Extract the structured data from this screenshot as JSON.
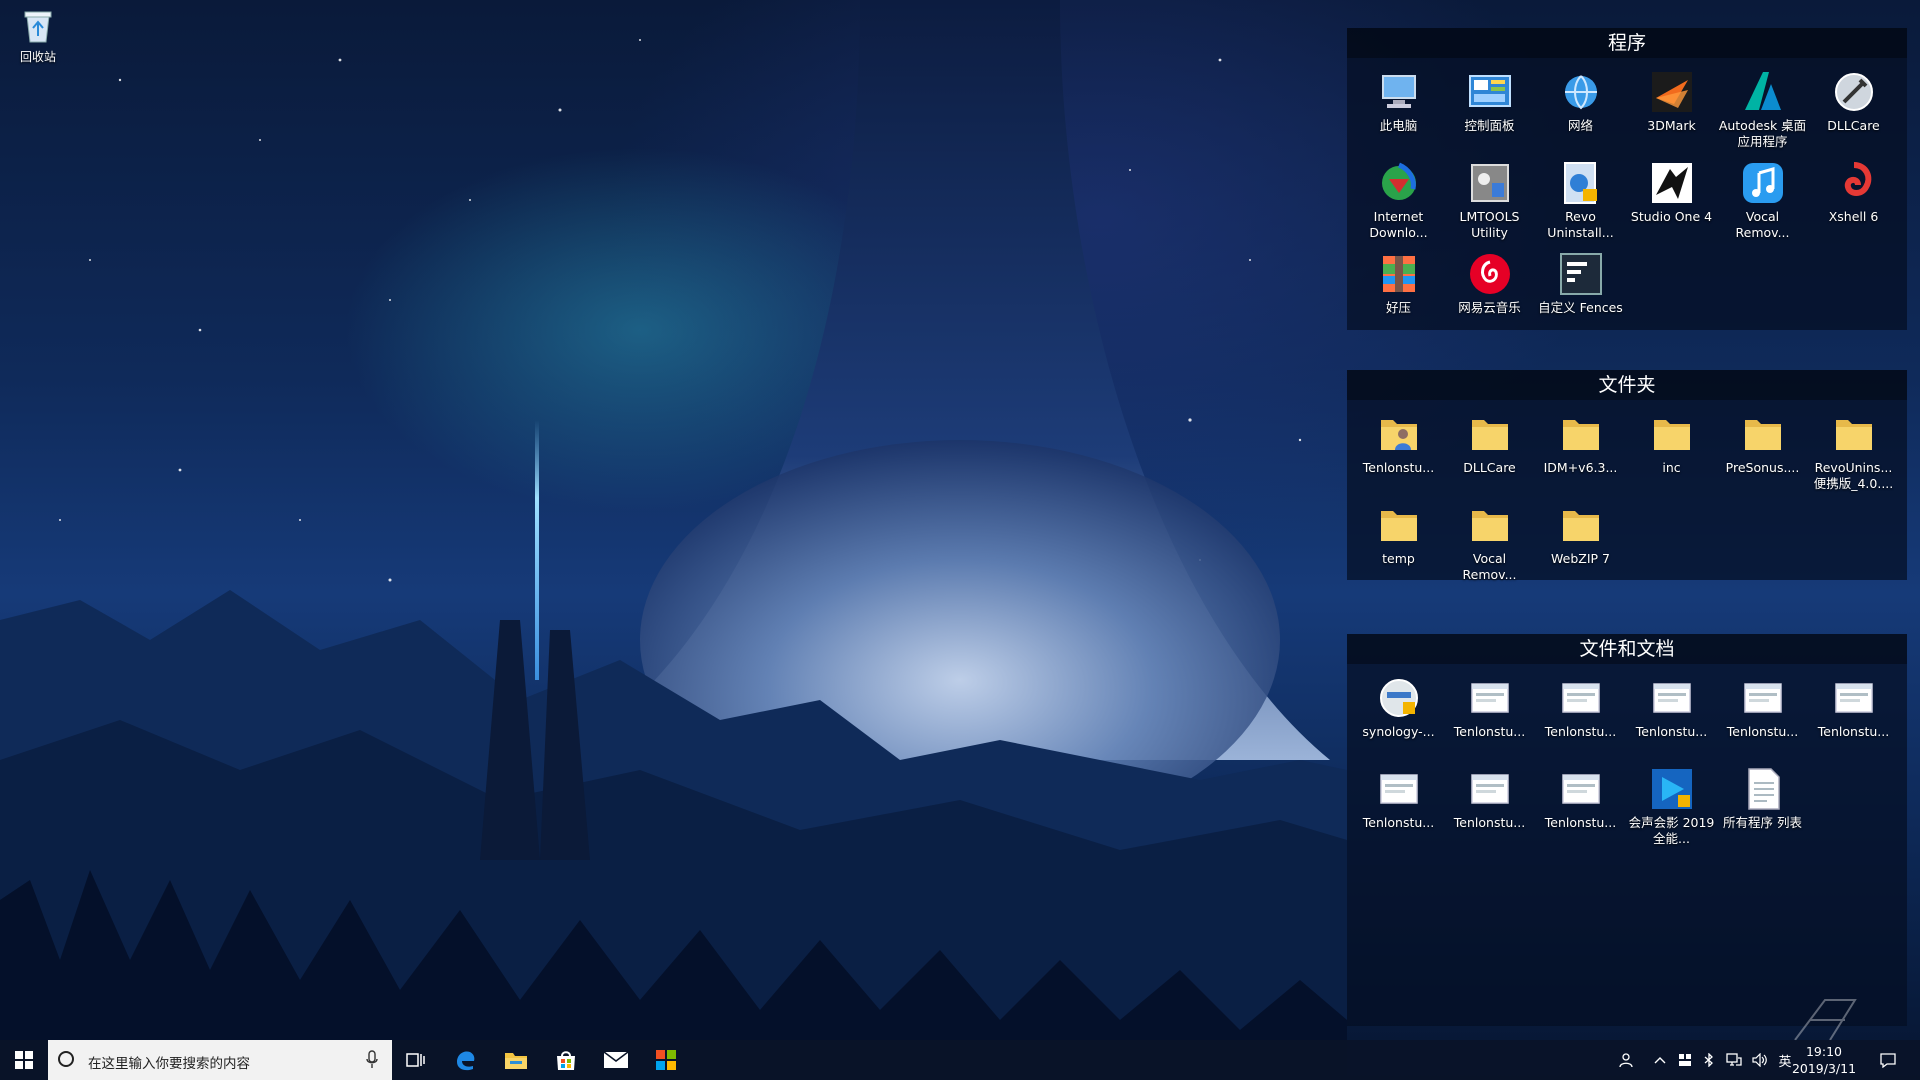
{
  "desktop": {
    "recycle_bin": {
      "label": "回收站",
      "icon": "recycle-bin-icon"
    }
  },
  "fences": [
    {
      "title": "程序",
      "items": [
        {
          "label": "此电脑",
          "icon": "computer-icon"
        },
        {
          "label": "控制面板",
          "icon": "control-panel-icon"
        },
        {
          "label": "网络",
          "icon": "network-icon"
        },
        {
          "label": "3DMark",
          "icon": "3dmark-icon"
        },
        {
          "label": "Autodesk 桌面应用程序",
          "icon": "autodesk-icon"
        },
        {
          "label": "DLLCare",
          "icon": "dllcare-icon"
        },
        {
          "label": "Internet Downlo...",
          "icon": "idm-icon"
        },
        {
          "label": "LMTOOLS Utility",
          "icon": "lmtools-icon"
        },
        {
          "label": "Revo Uninstall...",
          "icon": "revo-icon"
        },
        {
          "label": "Studio One 4",
          "icon": "studio-one-icon"
        },
        {
          "label": "Vocal Remov...",
          "icon": "vocal-remover-icon"
        },
        {
          "label": "Xshell 6",
          "icon": "xshell-icon"
        },
        {
          "label": "好压",
          "icon": "haozip-icon"
        },
        {
          "label": "网易云音乐",
          "icon": "netease-music-icon"
        },
        {
          "label": "自定义 Fences",
          "icon": "fences-icon"
        }
      ]
    },
    {
      "title": "文件夹",
      "items": [
        {
          "label": "Tenlonstu...",
          "icon": "folder-user-icon"
        },
        {
          "label": "DLLCare",
          "icon": "folder-icon"
        },
        {
          "label": "IDM+v6.3...",
          "icon": "folder-icon"
        },
        {
          "label": "inc",
          "icon": "folder-icon"
        },
        {
          "label": "PreSonus....",
          "icon": "folder-icon"
        },
        {
          "label": "RevoUnins... 便携版_4.0....",
          "icon": "folder-icon"
        },
        {
          "label": "temp",
          "icon": "folder-icon"
        },
        {
          "label": "Vocal Remov...",
          "icon": "folder-icon"
        },
        {
          "label": "WebZIP 7",
          "icon": "folder-icon"
        }
      ]
    },
    {
      "title": "文件和文档",
      "items": [
        {
          "label": "synology-...",
          "icon": "synology-installer-icon"
        },
        {
          "label": "Tenlonstu...",
          "icon": "screenshot-file-icon"
        },
        {
          "label": "Tenlonstu...",
          "icon": "screenshot-file-icon"
        },
        {
          "label": "Tenlonstu...",
          "icon": "screenshot-file-icon"
        },
        {
          "label": "Tenlonstu...",
          "icon": "screenshot-file-icon"
        },
        {
          "label": "Tenlonstu...",
          "icon": "screenshot-file-icon"
        },
        {
          "label": "Tenlonstu...",
          "icon": "screenshot-file-icon"
        },
        {
          "label": "Tenlonstu...",
          "icon": "screenshot-file-icon"
        },
        {
          "label": "Tenlonstu...",
          "icon": "screenshot-file-icon"
        },
        {
          "label": "会声会影 2019全能...",
          "icon": "videostudio-icon"
        },
        {
          "label": "所有程序 列表",
          "icon": "text-file-icon"
        }
      ]
    }
  ],
  "taskbar": {
    "search_placeholder": "在这里输入你要搜索的内容",
    "pinned": [
      {
        "name": "task-view-button",
        "icon": "task-view-icon"
      },
      {
        "name": "edge-button",
        "icon": "edge-icon"
      },
      {
        "name": "file-explorer-button",
        "icon": "folder-icon"
      },
      {
        "name": "store-button",
        "icon": "store-icon"
      },
      {
        "name": "mail-button",
        "icon": "mail-icon"
      },
      {
        "name": "app-button",
        "icon": "colorful-app-icon"
      }
    ],
    "tray": {
      "ime": "英",
      "time": "19:10",
      "date": "2019/3/11"
    }
  },
  "colors": {
    "fence_bg": "#0a1730",
    "taskbar_bg": "#0a1428",
    "search_bg": "#f2f2f2",
    "accent": "#1e88e5"
  }
}
